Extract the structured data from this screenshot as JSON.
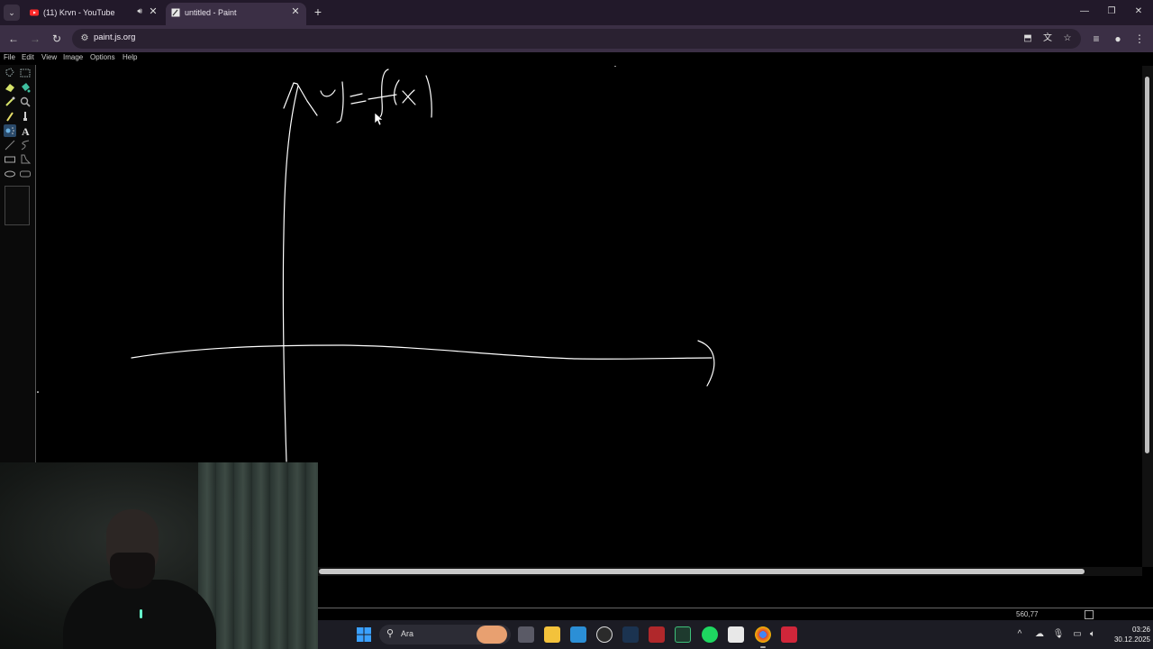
{
  "browser": {
    "tabs": [
      {
        "title": "(11) Krvn - YouTube",
        "icon": "youtube-icon",
        "audio": "speaker-icon"
      },
      {
        "title": "untitled - Paint",
        "icon": "paint-icon"
      }
    ],
    "url": "paint.js.org"
  },
  "paint": {
    "menu": [
      "File",
      "Edit",
      "View",
      "Image",
      "Options",
      "Help"
    ],
    "tools": [
      "free-form-select-icon",
      "select-icon",
      "eraser-icon",
      "fill-icon",
      "color-picker-icon",
      "magnifier-icon",
      "pencil-icon",
      "brush-icon",
      "airbrush-icon",
      "text-icon",
      "line-icon",
      "curve-icon",
      "rectangle-icon",
      "polygon-icon",
      "ellipse-icon",
      "rounded-rectangle-icon"
    ],
    "canvas": {
      "background": "#000000",
      "stroke_color": "#ffffff",
      "drawing_text": "y=f(x)"
    },
    "status": {
      "cursor_position": "560,77"
    }
  },
  "taskbar": {
    "search_label": "Ara",
    "time": "03:26",
    "date": "30.12.2025",
    "pinned": [
      "windows-start-icon",
      "search-icon",
      "task-view-icon",
      "file-explorer-icon",
      "app-icon",
      "steam-icon",
      "news-icon",
      "app-icon-2",
      "spotify-icon",
      "app-icon-3",
      "chrome-icon",
      "app-icon-4"
    ]
  }
}
